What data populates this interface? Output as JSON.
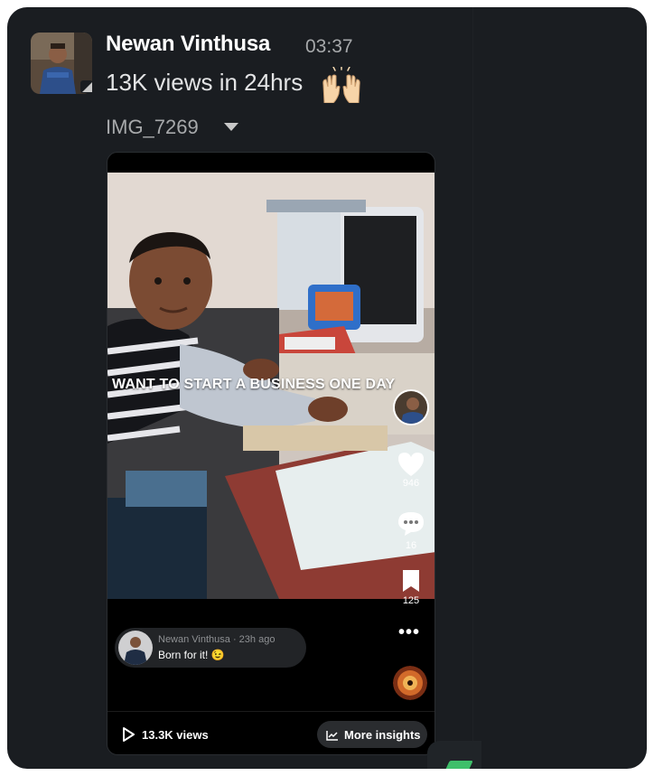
{
  "message": {
    "author": "Newan Vinthusa",
    "time": "03:37",
    "text": "13K views in 24hrs",
    "emoji": "raised-hands"
  },
  "attachment": {
    "file_name": "IMG_7269",
    "video": {
      "overlay_caption": "WANT TO START A  BUSINESS ONE DAY",
      "likes": "946",
      "comments": "16",
      "saves": "125",
      "comment": {
        "author_line": "Newan Vinthusa · 23h ago",
        "text": "Born for it! 😉"
      },
      "views": "13.3K views",
      "insights_label": "More insights"
    }
  },
  "colors": {
    "background": "#1a1d21",
    "text_primary": "#ffffff",
    "text_secondary": "#a7a9ab",
    "accent_green": "#3fbf6a"
  }
}
